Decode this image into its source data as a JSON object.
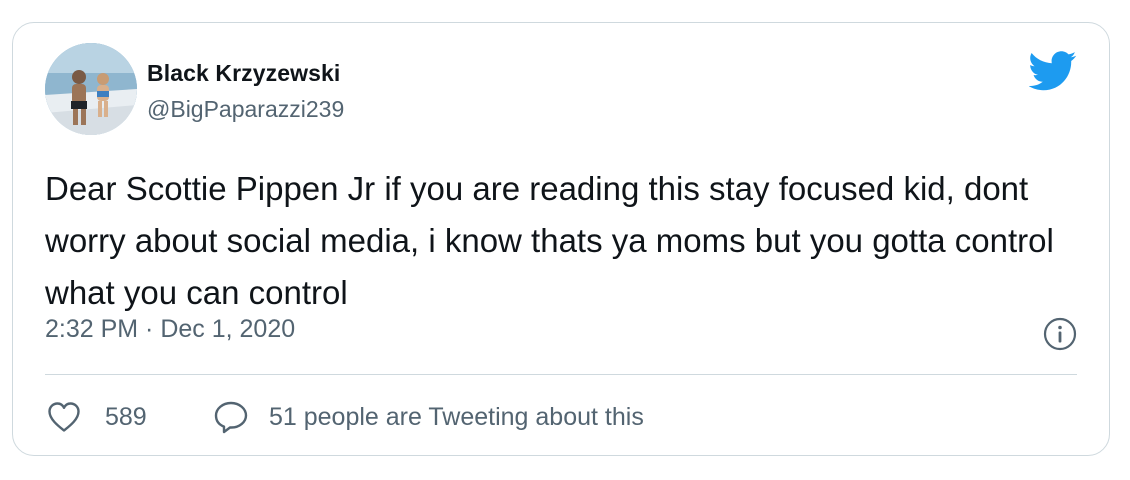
{
  "tweet": {
    "author": {
      "display_name": "Black Krzyzewski",
      "handle": "@BigPaparazzi239"
    },
    "text": "Dear Scottie Pippen Jr if you are reading this stay focused kid, dont worry about social media, i know thats ya moms but you gotta control what you can control",
    "timestamp": "2:32 PM · Dec 1, 2020",
    "likes": "589",
    "conversation": "51 people are Tweeting about this"
  },
  "icons": {
    "brand": "twitter-bird-icon",
    "info": "info-icon",
    "like": "heart-icon",
    "reply": "speech-bubble-icon"
  },
  "colors": {
    "brand": "#1d9bf0",
    "text": "#0f1419",
    "secondary": "#536471",
    "border": "#cfd9de"
  }
}
